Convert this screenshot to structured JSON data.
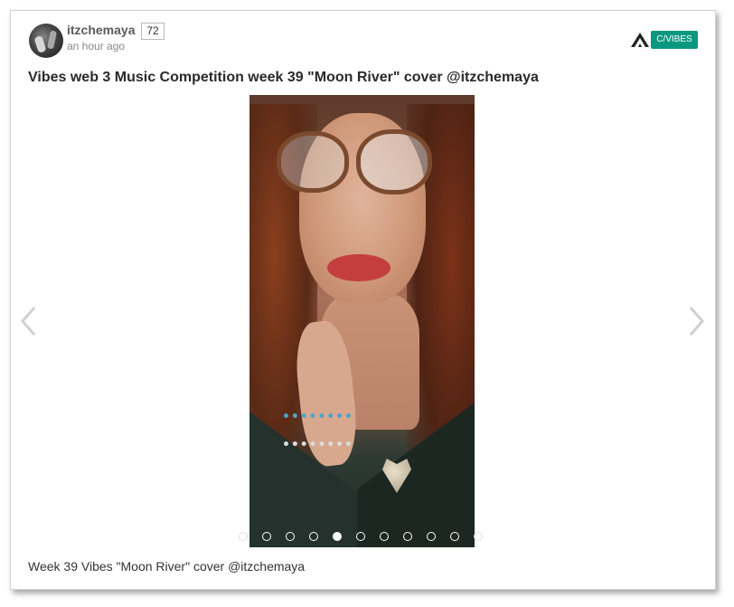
{
  "post": {
    "author": "itzchemaya",
    "reputation": "72",
    "time": "an hour ago",
    "community_badge": "C/VIBES",
    "title": "Vibes web 3 Music Competition week 39 \"Moon River\" cover @itzchemaya",
    "caption": "Week 39 Vibes \"Moon River\" cover @itzchemaya"
  },
  "carousel": {
    "slide_count": 11,
    "active_index": 4,
    "prev_icon": "chevron-left-icon",
    "next_icon": "chevron-right-icon"
  },
  "colors": {
    "badge": "#0a9980",
    "author": "#5b5b5b",
    "title": "#2a2a2a"
  }
}
